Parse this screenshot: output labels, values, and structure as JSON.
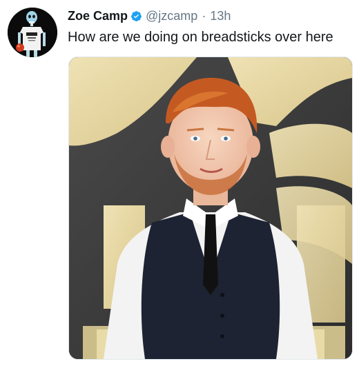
{
  "tweet": {
    "display_name": "Zoe Camp",
    "handle": "@jzcamp",
    "separator": "·",
    "timestamp": "13h",
    "text": "How are we doing on breadsticks over here",
    "verified_icon": "verified-badge-icon",
    "avatar_icon": "skeleton-avatar-icon",
    "media_icon": "photo-icon",
    "colors": {
      "name": "#14171a",
      "meta": "#657786",
      "verified": "#1da1f2"
    }
  }
}
